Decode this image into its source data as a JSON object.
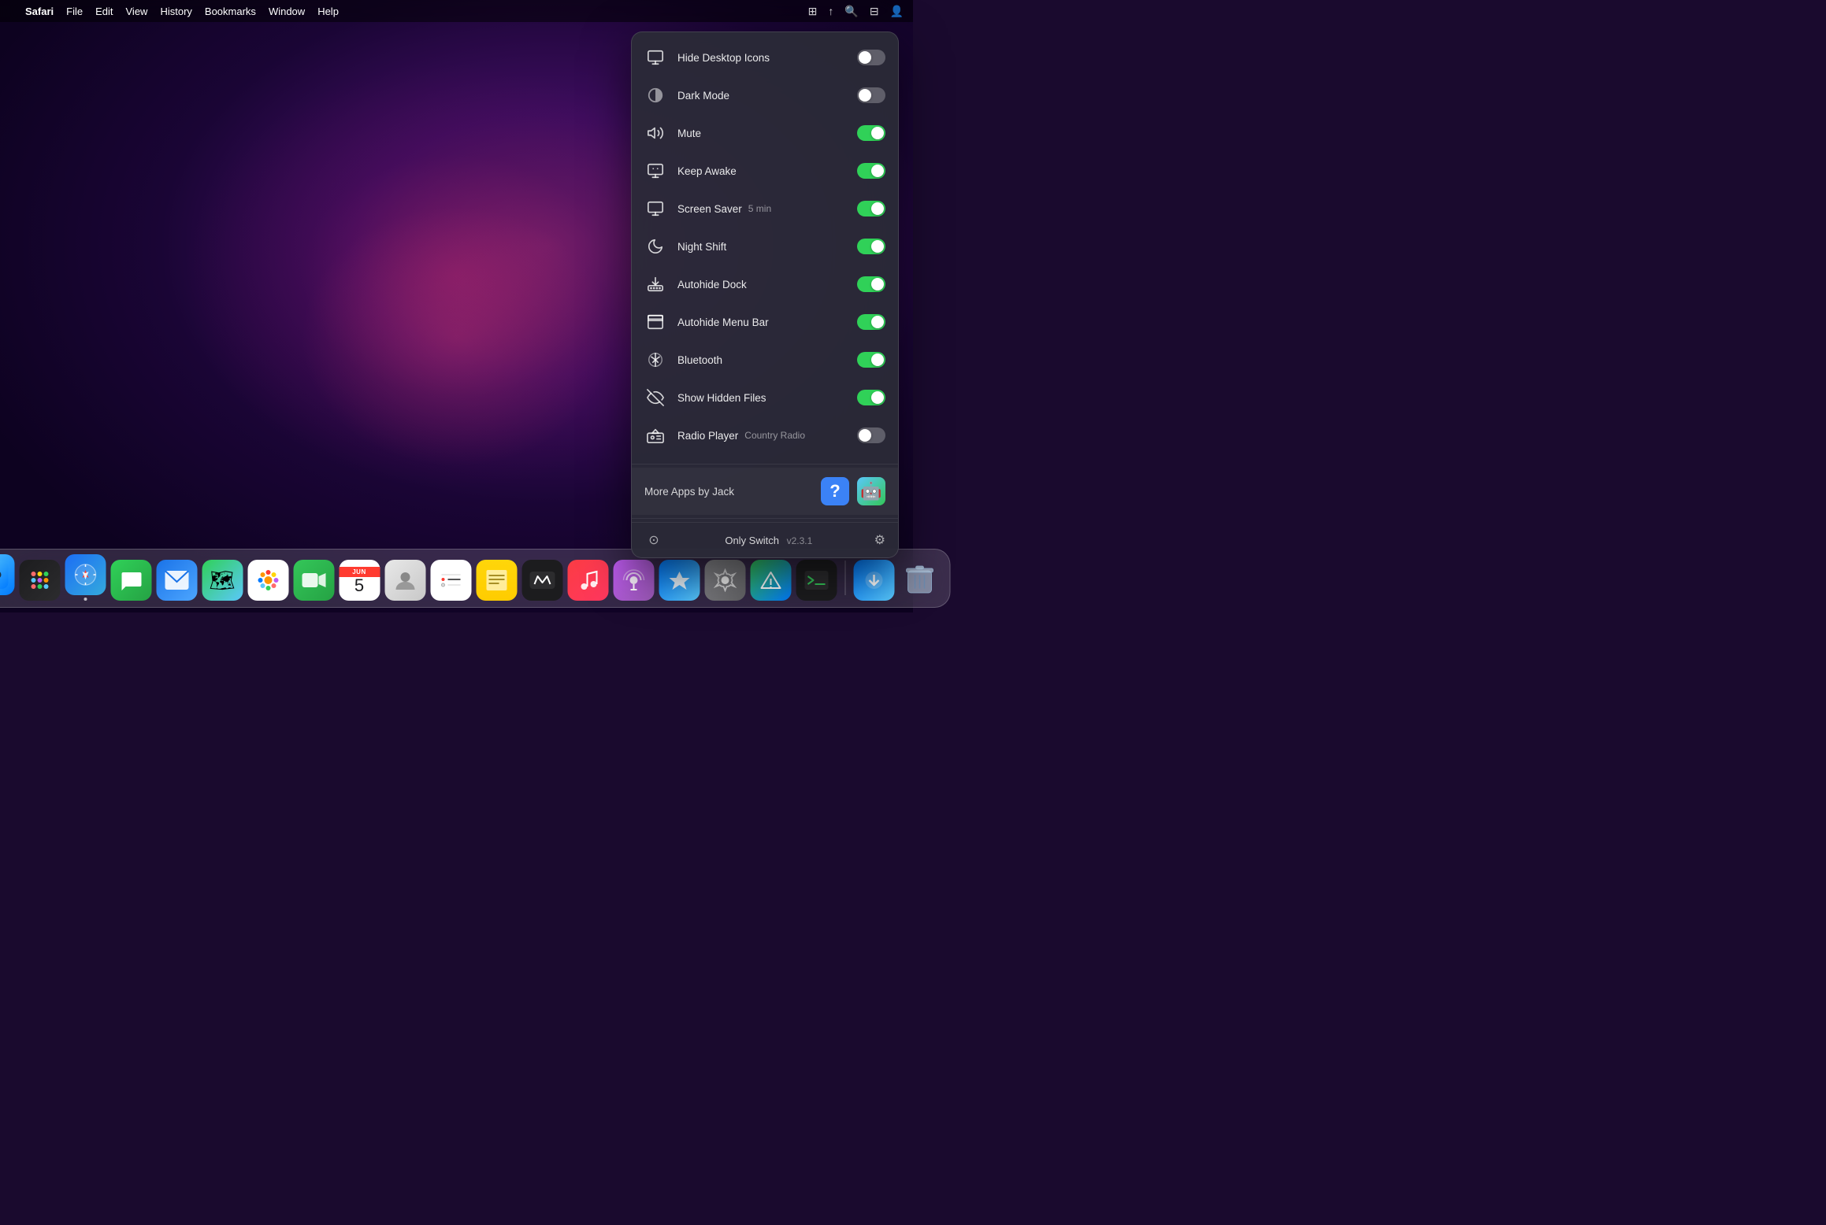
{
  "menubar": {
    "apple": "⌘",
    "app": "Safari",
    "items": [
      "File",
      "Edit",
      "View",
      "History",
      "Bookmarks",
      "Window",
      "Help"
    ]
  },
  "panel": {
    "arrow_visible": true,
    "switches": [
      {
        "id": "hide-desktop-icons",
        "label": "Hide Desktop Icons",
        "sublabel": "",
        "state": "off",
        "icon": "monitor"
      },
      {
        "id": "dark-mode",
        "label": "Dark Mode",
        "sublabel": "",
        "state": "off",
        "icon": "moon-fill"
      },
      {
        "id": "mute",
        "label": "Mute",
        "sublabel": "",
        "state": "on",
        "icon": "volume"
      },
      {
        "id": "keep-awake",
        "label": "Keep Awake",
        "sublabel": "",
        "state": "on",
        "icon": "sleep"
      },
      {
        "id": "screen-saver",
        "label": "Screen Saver",
        "sublabel": "5 min",
        "state": "on",
        "icon": "monitor-small"
      },
      {
        "id": "night-shift",
        "label": "Night Shift",
        "sublabel": "",
        "state": "on",
        "icon": "moon-crescent"
      },
      {
        "id": "autohide-dock",
        "label": "Autohide Dock",
        "sublabel": "",
        "state": "on",
        "icon": "dock"
      },
      {
        "id": "autohide-menu-bar",
        "label": "Autohide Menu Bar",
        "sublabel": "",
        "state": "on",
        "icon": "menu-bar"
      },
      {
        "id": "bluetooth",
        "label": "Bluetooth",
        "sublabel": "",
        "state": "on",
        "icon": "bluetooth"
      },
      {
        "id": "show-hidden-files",
        "label": "Show Hidden Files",
        "sublabel": "",
        "state": "on",
        "icon": "eye-slash"
      },
      {
        "id": "radio-player",
        "label": "Radio Player",
        "sublabel": "Country Radio",
        "state": "off",
        "icon": "radio"
      }
    ],
    "more_apps": {
      "label": "More Apps by Jack",
      "icon1": "?",
      "icon2": "🤖"
    },
    "footer": {
      "icon": "⊙",
      "app_name": "Only Switch",
      "version": "v2.3.1",
      "gear": "⚙"
    }
  },
  "dock": {
    "apps": [
      {
        "id": "finder",
        "label": "Finder",
        "icon": "🔍",
        "class": "finder",
        "has_dot": true
      },
      {
        "id": "launchpad",
        "label": "Launchpad",
        "icon": "⬛",
        "class": "launchpad",
        "has_dot": false
      },
      {
        "id": "safari",
        "label": "Safari",
        "icon": "🧭",
        "class": "safari",
        "has_dot": true
      },
      {
        "id": "messages",
        "label": "Messages",
        "icon": "💬",
        "class": "messages",
        "has_dot": false
      },
      {
        "id": "mail",
        "label": "Mail",
        "icon": "✉️",
        "class": "mail",
        "has_dot": false
      },
      {
        "id": "maps",
        "label": "Maps",
        "icon": "🗺",
        "class": "maps",
        "has_dot": false
      },
      {
        "id": "photos",
        "label": "Photos",
        "icon": "🌸",
        "class": "photos",
        "has_dot": false
      },
      {
        "id": "facetime",
        "label": "FaceTime",
        "icon": "📹",
        "class": "facetime",
        "has_dot": false
      },
      {
        "id": "calendar",
        "label": "Calendar",
        "icon": "📅",
        "class": "calendar",
        "has_dot": false
      },
      {
        "id": "contacts",
        "label": "Contacts",
        "icon": "👤",
        "class": "contacts",
        "has_dot": false
      },
      {
        "id": "reminders",
        "label": "Reminders",
        "icon": "☑️",
        "class": "reminders",
        "has_dot": false
      },
      {
        "id": "notes",
        "label": "Notes",
        "icon": "📝",
        "class": "notes",
        "has_dot": false
      },
      {
        "id": "appletv",
        "label": "Apple TV",
        "icon": "📺",
        "class": "appletv",
        "has_dot": false
      },
      {
        "id": "music",
        "label": "Music",
        "icon": "🎵",
        "class": "music",
        "has_dot": false
      },
      {
        "id": "podcasts",
        "label": "Podcasts",
        "icon": "🎙",
        "class": "podcasts",
        "has_dot": false
      },
      {
        "id": "appstore",
        "label": "App Store",
        "icon": "🅰",
        "class": "appstore",
        "has_dot": false
      },
      {
        "id": "sysprefs",
        "label": "System Preferences",
        "icon": "⚙️",
        "class": "sysprefs",
        "has_dot": false
      },
      {
        "id": "altimeter",
        "label": "Altimeter",
        "icon": "△",
        "class": "altimeter",
        "has_dot": false
      },
      {
        "id": "terminal",
        "label": "Terminal",
        "icon": ">_",
        "class": "terminal",
        "has_dot": false
      },
      {
        "separator": true
      },
      {
        "id": "downloads",
        "label": "Downloads",
        "icon": "⬇",
        "class": "downloads",
        "has_dot": false
      },
      {
        "id": "trash",
        "label": "Trash",
        "icon": "🗑",
        "class": "trash",
        "has_dot": false
      }
    ]
  }
}
